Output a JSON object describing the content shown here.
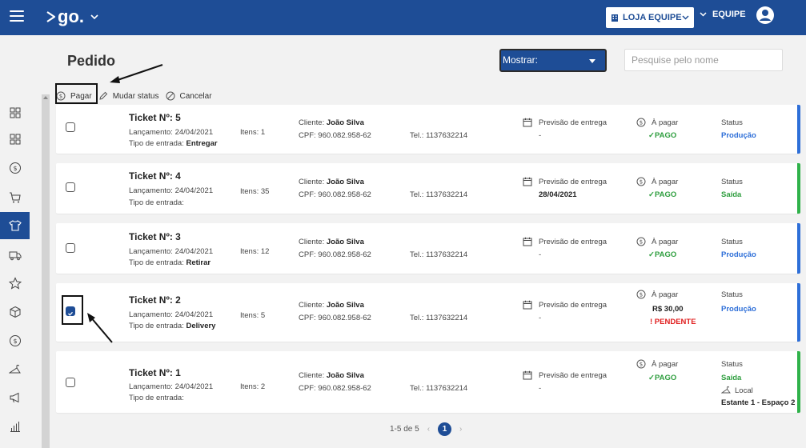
{
  "topbar": {
    "logo": "go.",
    "store_label": "LOJA EQUIPE",
    "team_label": "EQUIPE"
  },
  "page": {
    "title": "Pedido",
    "show_label": "Mostrar:",
    "search_placeholder": "Pesquise pelo nome"
  },
  "actions": {
    "pay": "Pagar",
    "change_status": "Mudar status",
    "cancel": "Cancelar"
  },
  "labels": {
    "release_prefix": "Lançamento: ",
    "entry_prefix": "Tipo de entrada: ",
    "items_prefix": "Itens: ",
    "client_prefix": "Cliente: ",
    "cpf_prefix": "CPF: ",
    "phone_prefix": "Tel.: ",
    "delivery_forecast": "Previsão de entrega",
    "to_pay": "À pagar",
    "status": "Status"
  },
  "tickets": [
    {
      "title": "Ticket Nº: 5",
      "release": "24/04/2021",
      "entry": "Entregar",
      "items": "1",
      "client": "João Silva",
      "cpf": "960.082.958-62",
      "phone": "1137632214",
      "forecast": "-",
      "pay_status": "PAGO",
      "status": "Produção",
      "stripe": "#2e6fd8"
    },
    {
      "title": "Ticket Nº: 4",
      "release": "24/04/2021",
      "entry": "",
      "items": "35",
      "client": "João Silva",
      "cpf": "960.082.958-62",
      "phone": "1137632214",
      "forecast": "28/04/2021",
      "pay_status": "PAGO",
      "status": "Saída",
      "stripe": "#2fb24a"
    },
    {
      "title": "Ticket Nº: 3",
      "release": "24/04/2021",
      "entry": "Retirar",
      "items": "12",
      "client": "João Silva",
      "cpf": "960.082.958-62",
      "phone": "1137632214",
      "forecast": "-",
      "pay_status": "PAGO",
      "status": "Produção",
      "stripe": "#2e6fd8"
    },
    {
      "title": "Ticket Nº: 2",
      "release": "24/04/2021",
      "entry": "Delivery",
      "items": "5",
      "client": "João Silva",
      "cpf": "960.082.958-62",
      "phone": "1137632214",
      "forecast": "-",
      "amount": "R$ 30,00",
      "pay_status": "! PENDENTE",
      "status": "Produção",
      "stripe": "#2e6fd8"
    },
    {
      "title": "Ticket Nº: 1",
      "release": "24/04/2021",
      "entry": "",
      "items": "2",
      "client": "João Silva",
      "cpf": "960.082.958-62",
      "phone": "1137632214",
      "forecast": "-",
      "pay_status": "PAGO",
      "status": "Saída",
      "location_label": "Local",
      "location": "Estante 1 - Espaço 2",
      "stripe": "#2fb24a"
    }
  ],
  "pager": {
    "range": "1-5 de 5",
    "current": "1"
  }
}
